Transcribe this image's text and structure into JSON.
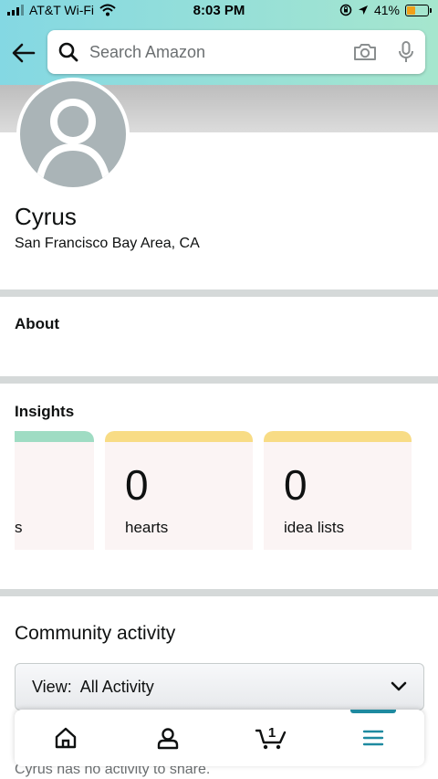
{
  "status_bar": {
    "carrier": "AT&T Wi-Fi",
    "time": "8:03 PM",
    "battery_percent": "41%",
    "battery_level": 0.41
  },
  "search": {
    "placeholder": "Search Amazon"
  },
  "profile": {
    "name": "Cyrus",
    "location": "San Francisco Bay Area, CA"
  },
  "sections": {
    "about": "About",
    "insights": "Insights"
  },
  "insights": [
    {
      "value": "",
      "label": "s",
      "band_color": "#9fdcc3"
    },
    {
      "value": "0",
      "label": "hearts",
      "band_color": "#f8dc85"
    },
    {
      "value": "0",
      "label": "idea lists",
      "band_color": "#f8dc85"
    }
  ],
  "community": {
    "title": "Community activity",
    "view_label": "View:  All Activity",
    "empty_text": "Cyrus has no activity to share."
  },
  "bottom_nav": {
    "cart_count": "1",
    "items": [
      "home-icon",
      "account-icon",
      "cart-icon",
      "menu-icon"
    ],
    "active_index": 3,
    "accent_color": "#1e8aa0"
  }
}
